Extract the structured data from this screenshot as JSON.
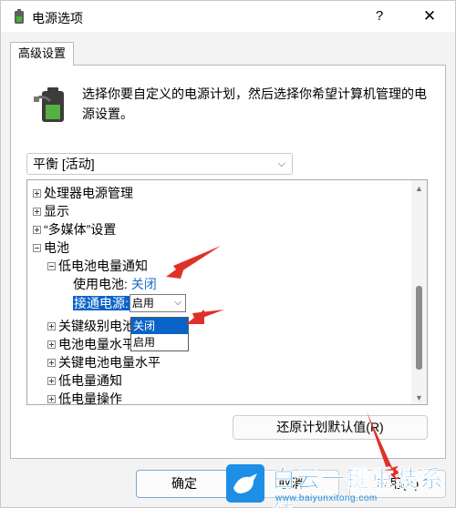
{
  "window": {
    "title": "电源选项",
    "help_glyph": "?",
    "close_glyph": "✕"
  },
  "tab": {
    "label": "高级设置"
  },
  "description": "选择你要自定义的电源计划，然后选择你希望计算机管理的电源设置。",
  "plan_select": {
    "value": "平衡 [活动]"
  },
  "tree": {
    "items": [
      {
        "label": "处理器电源管理"
      },
      {
        "label": "显示"
      },
      {
        "label": "“多媒体”设置"
      },
      {
        "label": "电池"
      },
      {
        "label": "低电池电量通知"
      },
      {
        "label": "使用电池:",
        "value": "关闭"
      },
      {
        "label": "接通电源:",
        "value": "启用"
      },
      {
        "label": "关键级别电池"
      },
      {
        "label": "电池电量水平"
      },
      {
        "label": "关键电池电量水平"
      },
      {
        "label": "低电量通知"
      },
      {
        "label": "低电量操作"
      }
    ]
  },
  "dropdown": {
    "options": [
      "关闭",
      "启用"
    ],
    "selected": "关闭"
  },
  "buttons": {
    "restore": "还原计划默认值(R)",
    "ok": "确定",
    "cancel": "取消",
    "apply": "应用(A)"
  },
  "watermark": {
    "title": "白云一键重装系统",
    "url": "www.baiyunxitong.com"
  },
  "colors": {
    "accent": "#0a64c8",
    "link": "#1e6ac6",
    "annotation_arrow": "#e0302a",
    "watermark": "#1d8fe6"
  }
}
